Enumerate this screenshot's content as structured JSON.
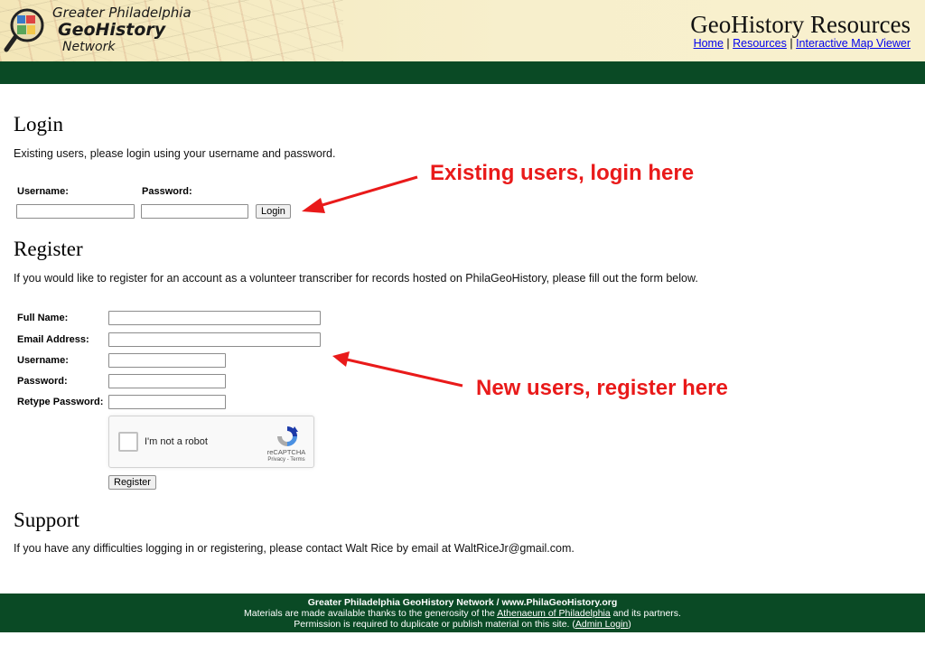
{
  "header": {
    "logo_line1": "Greater Philadelphia",
    "logo_line2": "GeoHistory",
    "logo_line3": "Network",
    "site_title": "GeoHistory Resources",
    "nav": {
      "home": "Home",
      "sep1": " | ",
      "resources": "Resources",
      "sep2": " | ",
      "map_viewer": "Interactive Map Viewer"
    }
  },
  "login": {
    "heading": "Login",
    "description": "Existing users, please login using your username and password.",
    "username_label": "Username:",
    "password_label": "Password:",
    "username_value": "",
    "password_value": "",
    "button_label": "Login"
  },
  "register": {
    "heading": "Register",
    "description": "If you would like to register for an account as a volunteer transcriber for records hosted on PhilaGeoHistory, please fill out the form below.",
    "fullname_label": "Full Name:",
    "email_label": "Email Address:",
    "username_label": "Username:",
    "password_label": "Password:",
    "retype_label": "Retype Password:",
    "button_label": "Register"
  },
  "captcha": {
    "label": "I'm not a robot",
    "brand": "reCAPTCHA",
    "terms": "Privacy - Terms"
  },
  "annotations": {
    "login_note": "Existing users, login here",
    "register_note": "New users, register here",
    "color": "#e91a1a"
  },
  "support": {
    "heading": "Support",
    "description": "If you have any difficulties logging in or registering, please contact Walt Rice by email at WaltRiceJr@gmail.com."
  },
  "footer": {
    "line1": "Greater Philadelphia GeoHistory Network / www.PhilaGeoHistory.org",
    "line2_pre": "Materials are made available thanks to the generosity of the ",
    "line2_link": "Athenaeum of Philadelphia",
    "line2_post": " and its partners.",
    "line3_pre": "Permission is required to duplicate or publish material on this site. (",
    "line3_link": "Admin Login",
    "line3_post": ")"
  },
  "colors": {
    "header_green": "#0a4a25",
    "link": "#0000ee",
    "header_bg": "#f6ecc5"
  }
}
